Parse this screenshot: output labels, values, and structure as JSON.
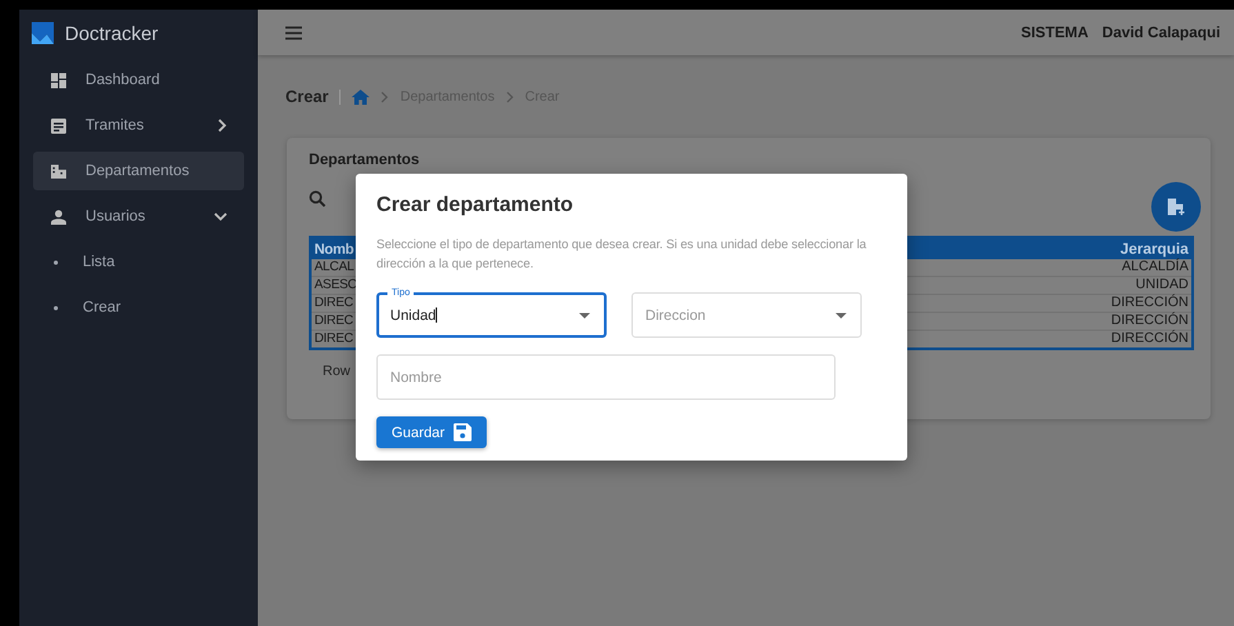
{
  "sidebar": {
    "brand": "Doctracker",
    "items": [
      {
        "label": "Dashboard",
        "selected": false
      },
      {
        "label": "Tramites",
        "selected": false,
        "expanded": false
      },
      {
        "label": "Departamentos",
        "selected": true
      },
      {
        "label": "Usuarios",
        "selected": false,
        "expanded": true,
        "children": [
          {
            "label": "Lista",
            "selected": false
          },
          {
            "label": "Crear",
            "selected": false
          }
        ]
      }
    ]
  },
  "header": {
    "role": "SISTEMA",
    "user": "David Calapaqui"
  },
  "breadcrumb": {
    "title": "Crear",
    "items": [
      "Departamentos",
      "Crear"
    ]
  },
  "card": {
    "title": "Departamentos",
    "table": {
      "columns": [
        "Nomb",
        "Jerarquia"
      ],
      "rows": [
        [
          "ALCAL",
          "ALCALDÍA"
        ],
        [
          "ASESO",
          "UNIDAD"
        ],
        [
          "DIREC",
          "DIRECCIÓN"
        ],
        [
          "DIREC",
          "DIRECCIÓN"
        ],
        [
          "DIREC",
          "DIRECCIÓN"
        ]
      ]
    },
    "footer": "Row"
  },
  "dialog": {
    "title": "Crear departamento",
    "description": "Seleccione el tipo de departamento que desea crear. Si es una unidad debe seleccionar la dirección a la que pertenece.",
    "fields": [
      {
        "kind": "select",
        "label": "Tipo",
        "value": "Unidad",
        "focused": true
      },
      {
        "kind": "select",
        "placeholder": "Direccion",
        "focused": false
      },
      {
        "kind": "text",
        "placeholder": "Nombre",
        "focused": false
      }
    ],
    "button": "Guardar"
  }
}
